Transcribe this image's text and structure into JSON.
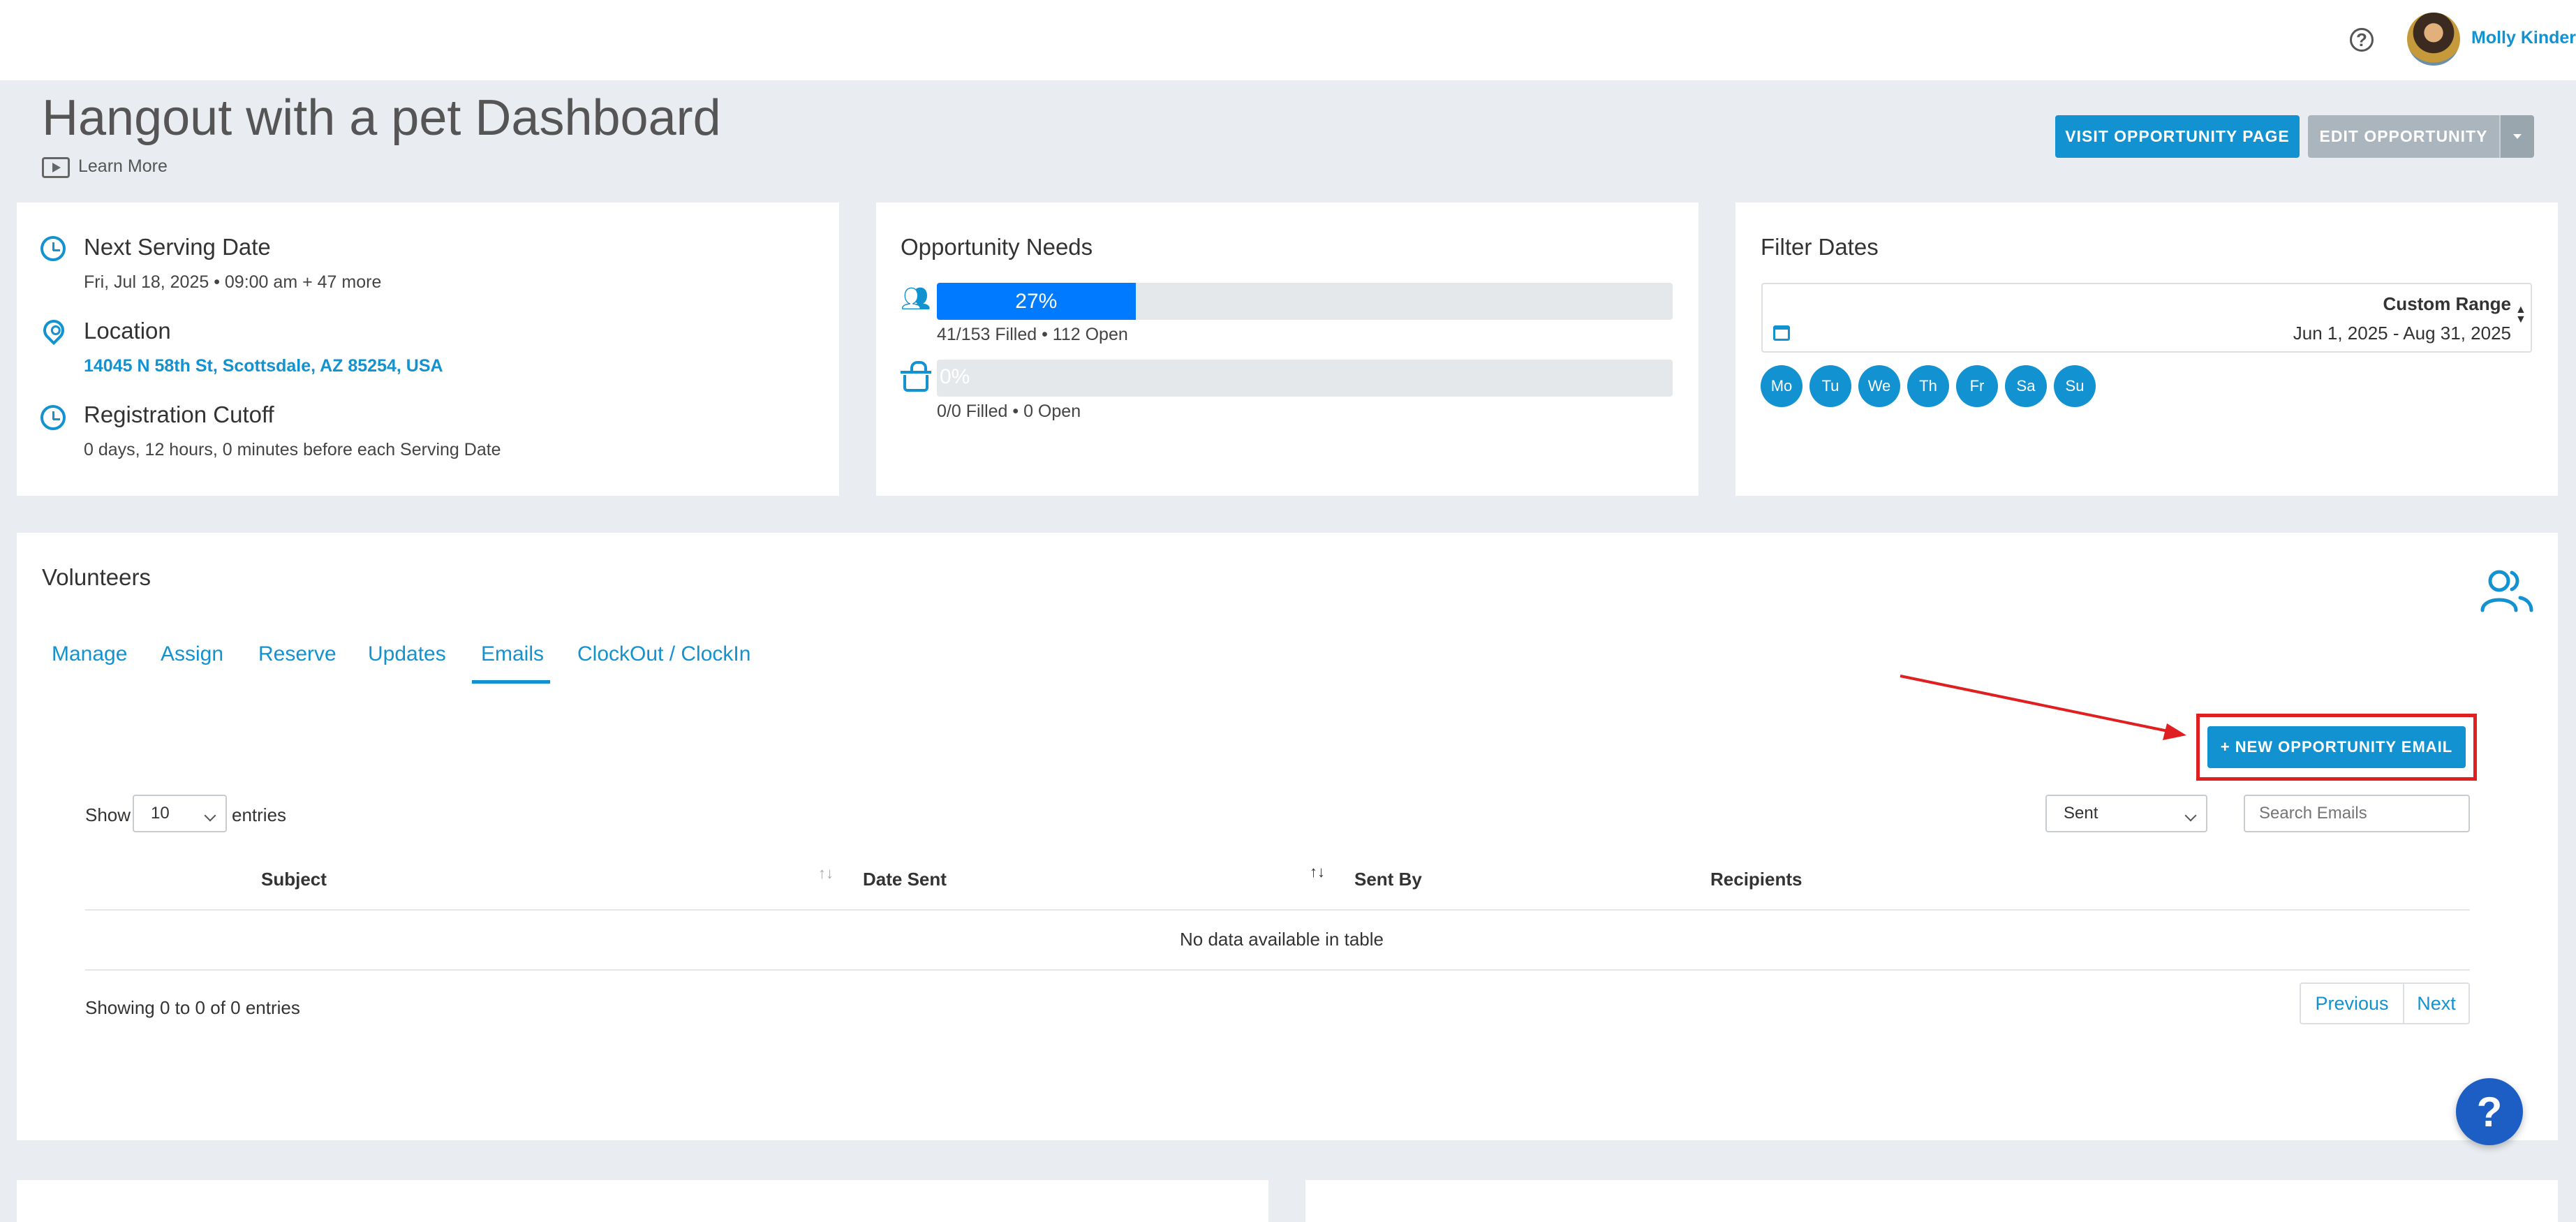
{
  "header": {
    "user_name": "Molly Kinder",
    "help_icon": "question-circle-icon"
  },
  "page": {
    "title": "Hangout with a pet Dashboard",
    "learn_more": "Learn More"
  },
  "actions": {
    "visit": "VISIT OPPORTUNITY PAGE",
    "edit": "EDIT OPPORTUNITY"
  },
  "info": {
    "next_serving_title": "Next Serving Date",
    "next_serving_value": "Fri, Jul 18, 2025 • 09:00 am + 47 more",
    "location_title": "Location",
    "location_value": "14045 N 58th St, Scottsdale, AZ 85254, USA",
    "cutoff_title": "Registration Cutoff",
    "cutoff_value": "0 days, 12 hours, 0 minutes before each Serving Date"
  },
  "needs": {
    "title": "Opportunity Needs",
    "volunteers": {
      "percent_label": "27%",
      "fill_fraction": 0.27,
      "detail": "41/153 Filled • 112 Open"
    },
    "items": {
      "percent_label": "0%",
      "fill_fraction": 0,
      "detail": "0/0 Filled • 0 Open"
    }
  },
  "filter": {
    "title": "Filter Dates",
    "range_label": "Custom Range",
    "range_value": "Jun 1, 2025 - Aug 31, 2025",
    "days": [
      "Mo",
      "Tu",
      "We",
      "Th",
      "Fr",
      "Sa",
      "Su"
    ]
  },
  "volunteers": {
    "title": "Volunteers",
    "tabs": [
      "Manage",
      "Assign",
      "Reserve",
      "Updates",
      "Emails",
      "ClockOut / ClockIn"
    ],
    "active_tab": "Emails",
    "new_email_button": "+ NEW OPPORTUNITY EMAIL",
    "show_label": "Show",
    "entries_label": "entries",
    "page_size": "10",
    "status_filter": "Sent",
    "search_placeholder": "Search Emails",
    "columns": [
      "Subject",
      "Date Sent",
      "Sent By",
      "Recipients"
    ],
    "empty_message": "No data available in table",
    "footer_info": "Showing 0 to 0 of 0 entries",
    "prev_label": "Previous",
    "next_label": "Next"
  },
  "colors": {
    "accent": "#1392d1",
    "progress": "#007bff",
    "annotation": "#e02020",
    "background": "#e9edf1"
  },
  "floating_help": "?"
}
